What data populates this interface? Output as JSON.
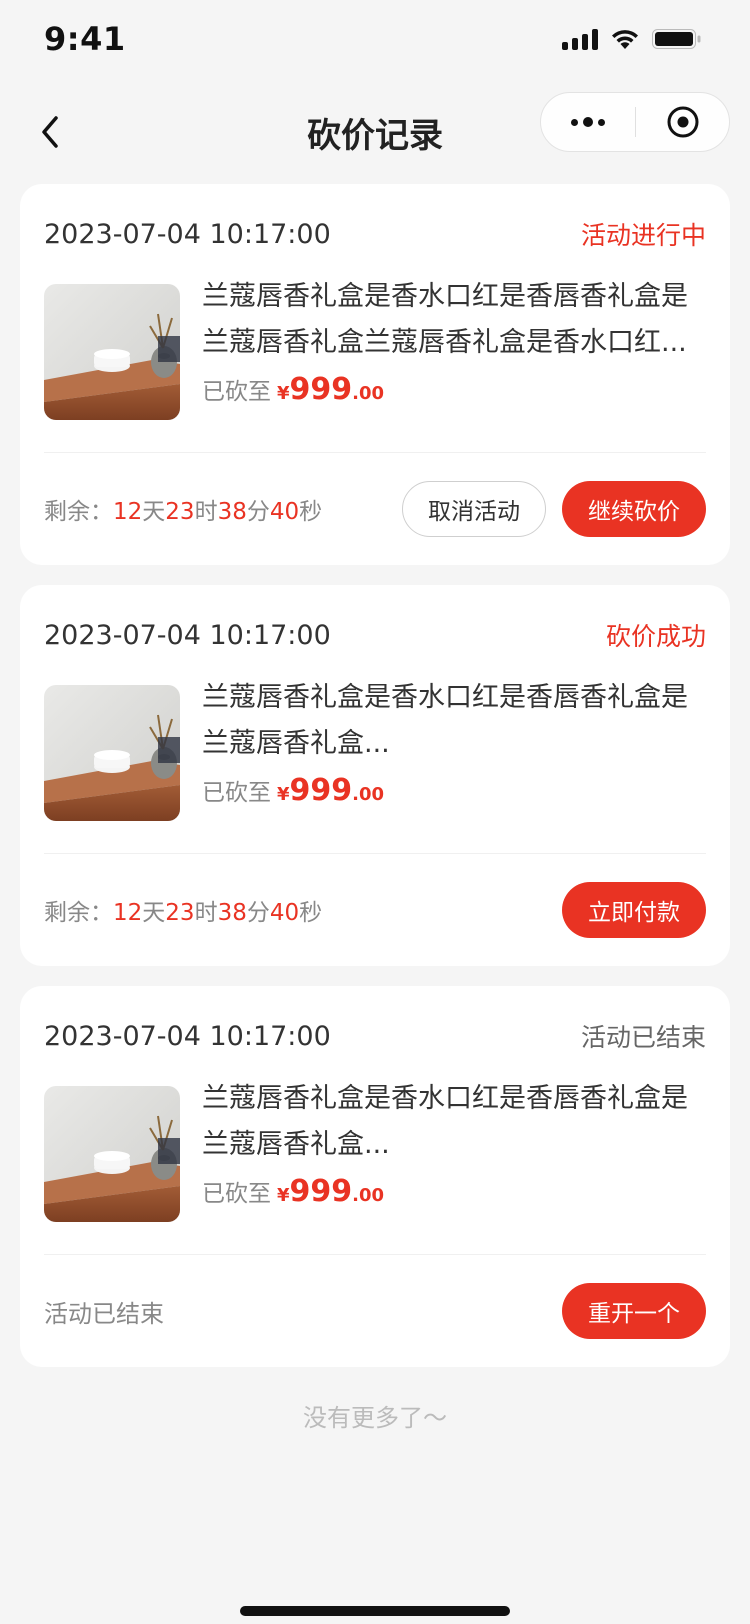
{
  "status_bar": {
    "time": "9:41"
  },
  "nav": {
    "title": "砍价记录"
  },
  "records": [
    {
      "time": "2023-07-04 10:17:00",
      "status": "活动进行中",
      "status_color": "#e93323",
      "name": "兰蔻唇香礼盒是香水口红是香唇香礼盒是兰蔻唇香礼盒兰蔻唇香礼盒是香水口红...",
      "price_label": "已砍至",
      "currency": "¥",
      "price_int": "999",
      "price_dec": ".00",
      "remaining": {
        "label": "剩余：",
        "days": "12",
        "day_unit": "天",
        "hours": "23",
        "hour_unit": "时",
        "minutes": "38",
        "minute_unit": "分",
        "seconds": "40",
        "second_unit": "秒"
      },
      "buttons": [
        {
          "label": "取消活动",
          "style": "outline"
        },
        {
          "label": "继续砍价",
          "style": "primary"
        }
      ]
    },
    {
      "time": "2023-07-04 10:17:00",
      "status": "砍价成功",
      "status_color": "#e93323",
      "name": "兰蔻唇香礼盒是香水口红是香唇香礼盒是兰蔻唇香礼盒...",
      "price_label": "已砍至",
      "currency": "¥",
      "price_int": "999",
      "price_dec": ".00",
      "remaining": {
        "label": "剩余：",
        "days": "12",
        "day_unit": "天",
        "hours": "23",
        "hour_unit": "时",
        "minutes": "38",
        "minute_unit": "分",
        "seconds": "40",
        "second_unit": "秒"
      },
      "buttons": [
        {
          "label": "立即付款",
          "style": "primary"
        }
      ]
    },
    {
      "time": "2023-07-04 10:17:00",
      "status": "活动已结束",
      "status_color": "#666666",
      "name": "兰蔻唇香礼盒是香水口红是香唇香礼盒是兰蔻唇香礼盒...",
      "price_label": "已砍至",
      "currency": "¥",
      "price_int": "999",
      "price_dec": ".00",
      "footer_text": "活动已结束",
      "buttons": [
        {
          "label": "重开一个",
          "style": "primary"
        }
      ]
    }
  ],
  "footer": {
    "no_more": "没有更多了～"
  },
  "colors": {
    "accent": "#e93323",
    "background": "#f5f5f5"
  }
}
